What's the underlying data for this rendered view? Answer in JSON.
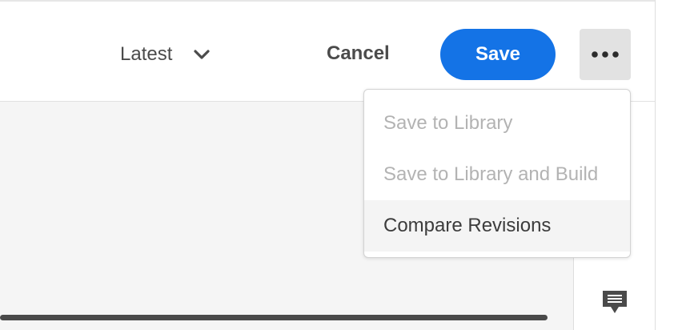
{
  "toolbar": {
    "version_label": "Latest",
    "cancel_label": "Cancel",
    "save_label": "Save"
  },
  "more_menu": {
    "items": [
      {
        "label": "Save to Library",
        "state": "disabled"
      },
      {
        "label": "Save to Library and Build",
        "state": "disabled"
      },
      {
        "label": "Compare Revisions",
        "state": "hover"
      }
    ]
  },
  "colors": {
    "accent": "#1473e6",
    "text": "#4b4b4b",
    "disabled_text": "#b3b3b3",
    "canvas_bg": "#f5f5f5"
  },
  "icons": {
    "version_dropdown": "chevron-down-icon",
    "more": "more-horizontal-icon",
    "comment": "comment-icon"
  }
}
